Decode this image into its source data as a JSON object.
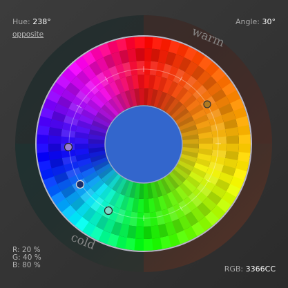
{
  "header": {
    "hue_label": "Hue:",
    "hue_value": "238°",
    "angle_label": "Angle:",
    "angle_value": "30°",
    "mode_link": "opposite"
  },
  "wheel": {
    "warm_label": "warm",
    "cold_label": "cold",
    "center_color": "#3366CC",
    "selectors": [
      {
        "name": "primary-hue-marker",
        "color": "#9b7fd4"
      },
      {
        "name": "secondary-hue-marker",
        "color": "#1a2e6a"
      },
      {
        "name": "complement-marker",
        "color": "#7dd8c8"
      },
      {
        "name": "warm-complement-marker",
        "color": "#b07a20"
      }
    ]
  },
  "footer": {
    "r": "R: 20 %",
    "g": "G: 40 %",
    "b": "B: 80 %",
    "rgb_label": "RGB:",
    "rgb_value": "3366CC"
  }
}
